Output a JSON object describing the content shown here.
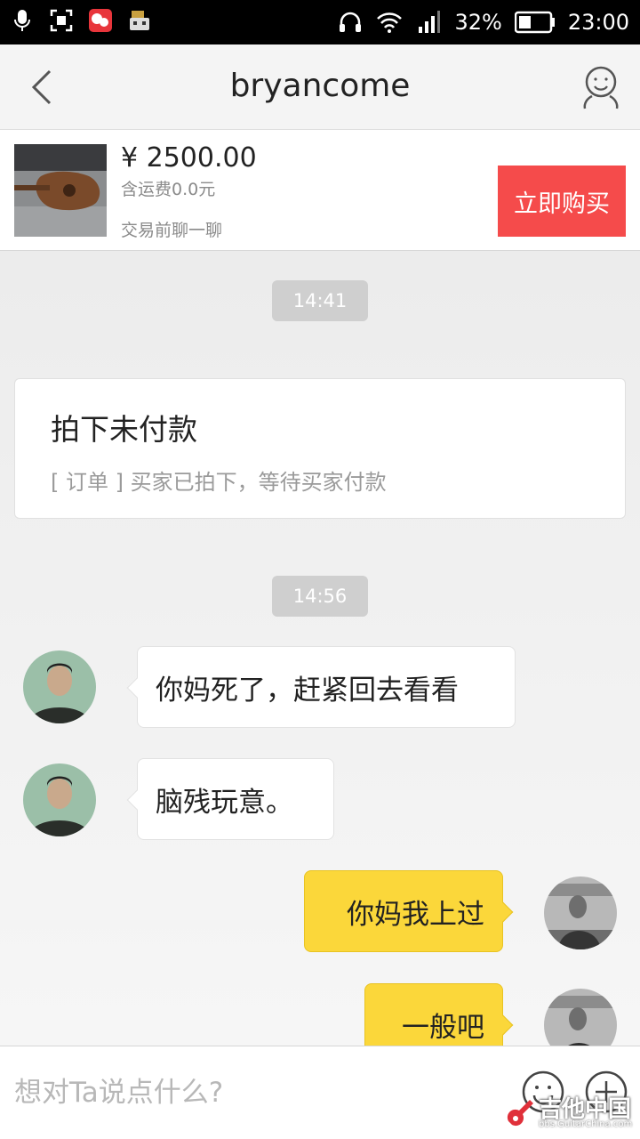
{
  "status_bar": {
    "battery_percent": "32%",
    "time": "23:00",
    "icons": [
      "microphone-icon",
      "screenshot-icon",
      "app-notification-icon",
      "robot-notification-icon",
      "headphones-icon",
      "wifi-icon",
      "signal-icon",
      "battery-icon"
    ]
  },
  "header": {
    "title": "bryancome",
    "back_icon": "chevron-left-icon",
    "profile_icon": "user-profile-icon"
  },
  "product": {
    "price": "¥ 2500.00",
    "shipping": "含运费0.0元",
    "hint": "交易前聊一聊",
    "buy_label": "立即购买",
    "buy_color": "#f54b4b"
  },
  "chat": {
    "timestamps": [
      "14:41",
      "14:56"
    ],
    "order": {
      "title": "拍下未付款",
      "description": "[ 订单 ] 买家已拍下，等待买家付款"
    },
    "messages": [
      {
        "side": "incoming",
        "text": "你妈死了，赶紧回去看看"
      },
      {
        "side": "incoming",
        "text": "脑残玩意。"
      },
      {
        "side": "outgoing",
        "text": "你妈我上过"
      },
      {
        "side": "outgoing",
        "text": "一般吧"
      }
    ],
    "outgoing_bubble_color": "#fbd73a",
    "incoming_bubble_color": "#ffffff"
  },
  "input": {
    "placeholder": "想对Ta说点什么?",
    "emoji_icon": "emoji-icon",
    "plus_icon": "plus-icon"
  },
  "watermark": {
    "text": "吉他中国",
    "sub": "bbs.GuitarChina.com"
  }
}
